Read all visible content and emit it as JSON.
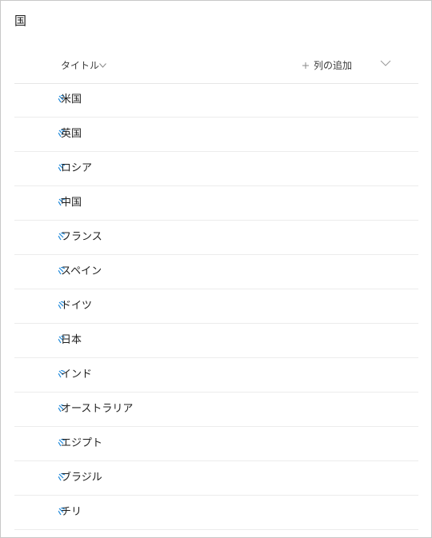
{
  "list": {
    "title": "国"
  },
  "columns": {
    "title_label": "タイトル",
    "add_column_label": "列の追加"
  },
  "icons": {
    "new_item": "new-item-sparkle-icon",
    "sort": "chevron-down-icon",
    "add": "plus-icon"
  },
  "colors": {
    "sparkle": "#1a86d9",
    "divider": "#ececec",
    "muted_icon": "#a0a0a0"
  },
  "rows": [
    {
      "title": "米国"
    },
    {
      "title": "英国"
    },
    {
      "title": "ロシア"
    },
    {
      "title": "中国"
    },
    {
      "title": "フランス"
    },
    {
      "title": "スペイン"
    },
    {
      "title": "ドイツ"
    },
    {
      "title": "日本"
    },
    {
      "title": "インド"
    },
    {
      "title": "オーストラリア"
    },
    {
      "title": "エジプト"
    },
    {
      "title": "ブラジル"
    },
    {
      "title": "チリ"
    }
  ]
}
